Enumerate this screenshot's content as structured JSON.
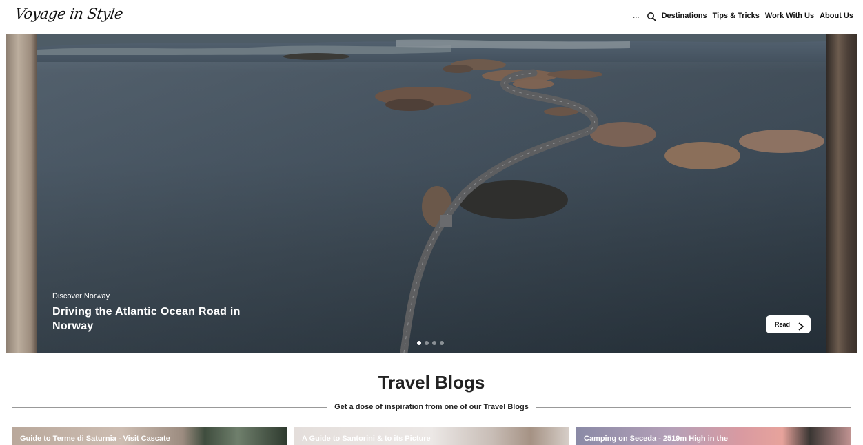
{
  "header": {
    "logo_text": "Voyage in Style",
    "more_label": "...",
    "nav": [
      "Destinations",
      "Tips & Tricks",
      "Work With Us",
      "About Us"
    ]
  },
  "hero": {
    "kicker": "Discover Norway",
    "title": "Driving the Atlantic Ocean Road in Norway",
    "read_label": "Read",
    "slide_count": 4,
    "active_slide": 1
  },
  "blogs": {
    "title": "Travel Blogs",
    "subtitle": "Get a dose of inspiration from one of our Travel Blogs",
    "cards": [
      "Guide to Terme di Saturnia - Visit Cascate",
      "A Guide to Santorini & to its Picture",
      "Camping on Seceda - 2519m High in the"
    ]
  }
}
